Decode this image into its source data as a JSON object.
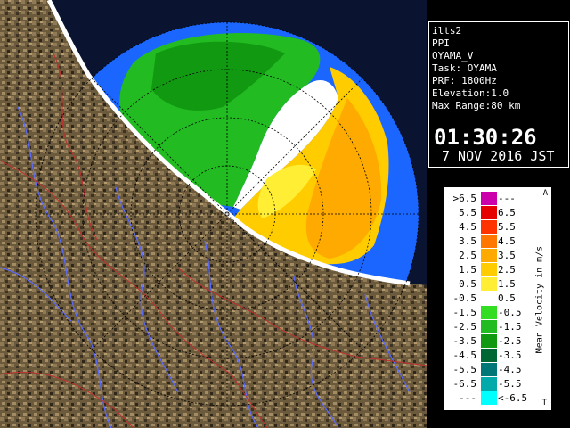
{
  "info": {
    "lines": [
      "ilts2",
      "PPI",
      "OYAMA_V",
      "Task: OYAMA",
      "PRF: 1800Hz",
      "Elevation:1.0",
      "Max Range:80 km"
    ],
    "time": "01:30:26",
    "date": "7 NOV 2016 JST"
  },
  "legend": {
    "title": "Mean Velocity in m/s",
    "corner_top": "A",
    "corner_bottom": "T",
    "rows": [
      {
        "lo": ">6.5",
        "hi": "---",
        "color": "#cc00aa"
      },
      {
        "lo": "5.5",
        "hi": "6.5",
        "color": "#e60000"
      },
      {
        "lo": "4.5",
        "hi": "5.5",
        "color": "#ff3300"
      },
      {
        "lo": "3.5",
        "hi": "4.5",
        "color": "#ff7700"
      },
      {
        "lo": "2.5",
        "hi": "3.5",
        "color": "#ffaa00"
      },
      {
        "lo": "1.5",
        "hi": "2.5",
        "color": "#ffcc00"
      },
      {
        "lo": "0.5",
        "hi": "1.5",
        "color": "#ffee33"
      },
      {
        "lo": "-0.5",
        "hi": "0.5",
        "color": "#ffffff"
      },
      {
        "lo": "-1.5",
        "hi": "-0.5",
        "color": "#33dd22"
      },
      {
        "lo": "-2.5",
        "hi": "-1.5",
        "color": "#22bb22"
      },
      {
        "lo": "-3.5",
        "hi": "-2.5",
        "color": "#119911"
      },
      {
        "lo": "-4.5",
        "hi": "-3.5",
        "color": "#006633"
      },
      {
        "lo": "-5.5",
        "hi": "-4.5",
        "color": "#007777"
      },
      {
        "lo": "-6.5",
        "hi": "-5.5",
        "color": "#00aaaa"
      },
      {
        "lo": "---",
        "hi": "<-6.5",
        "color": "#00ffff"
      }
    ]
  },
  "map": {
    "land_color": "#6b5a3c",
    "sea_range_color": "#1a66ff",
    "sea_outside_color": "#0a1430",
    "river_color": "#5a6aff",
    "boundary_color": "#c03030"
  }
}
